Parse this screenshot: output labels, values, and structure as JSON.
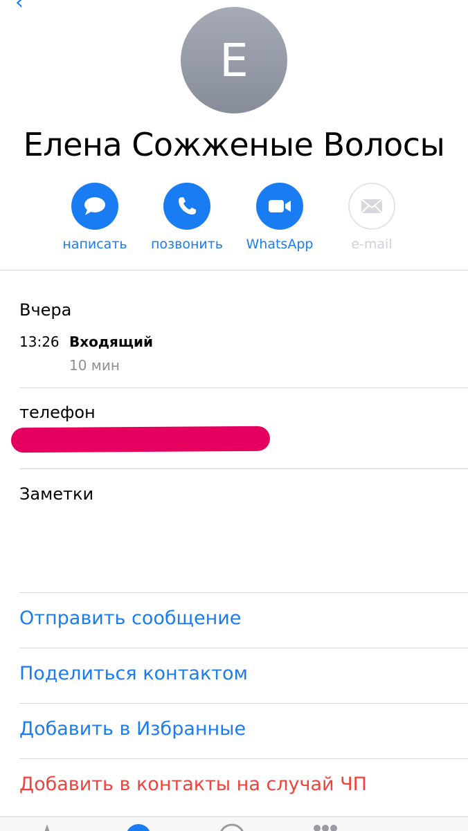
{
  "contact": {
    "initial": "E",
    "name": "Елена Сожженые Волосы"
  },
  "actions": [
    {
      "label": "написать",
      "icon": "message-icon",
      "enabled": true
    },
    {
      "label": "позвонить",
      "icon": "phone-icon",
      "enabled": true
    },
    {
      "label": "WhatsApp",
      "icon": "video-icon",
      "enabled": true
    },
    {
      "label": "e-mail",
      "icon": "mail-icon",
      "enabled": false
    }
  ],
  "recents": {
    "day": "Вчера",
    "time": "13:26",
    "type": "Входящий",
    "duration": "10 мин"
  },
  "phone": {
    "label": "телефон",
    "redacted": true
  },
  "notes": {
    "label": "Заметки"
  },
  "links": {
    "send_message": "Отправить сообщение",
    "share_contact": "Поделиться контактом",
    "add_favorites": "Добавить в Избранные",
    "add_emergency": "Добавить в контакты на случай ЧП"
  },
  "tabbar": {
    "tabs": [
      "star-icon",
      "clock-icon",
      "person-icon",
      "keypad-icon"
    ]
  },
  "colors": {
    "accent": "#1a7cf2",
    "destructive": "#f0423a",
    "redaction": "#e5005f",
    "disabled": "#cfd2d8"
  }
}
